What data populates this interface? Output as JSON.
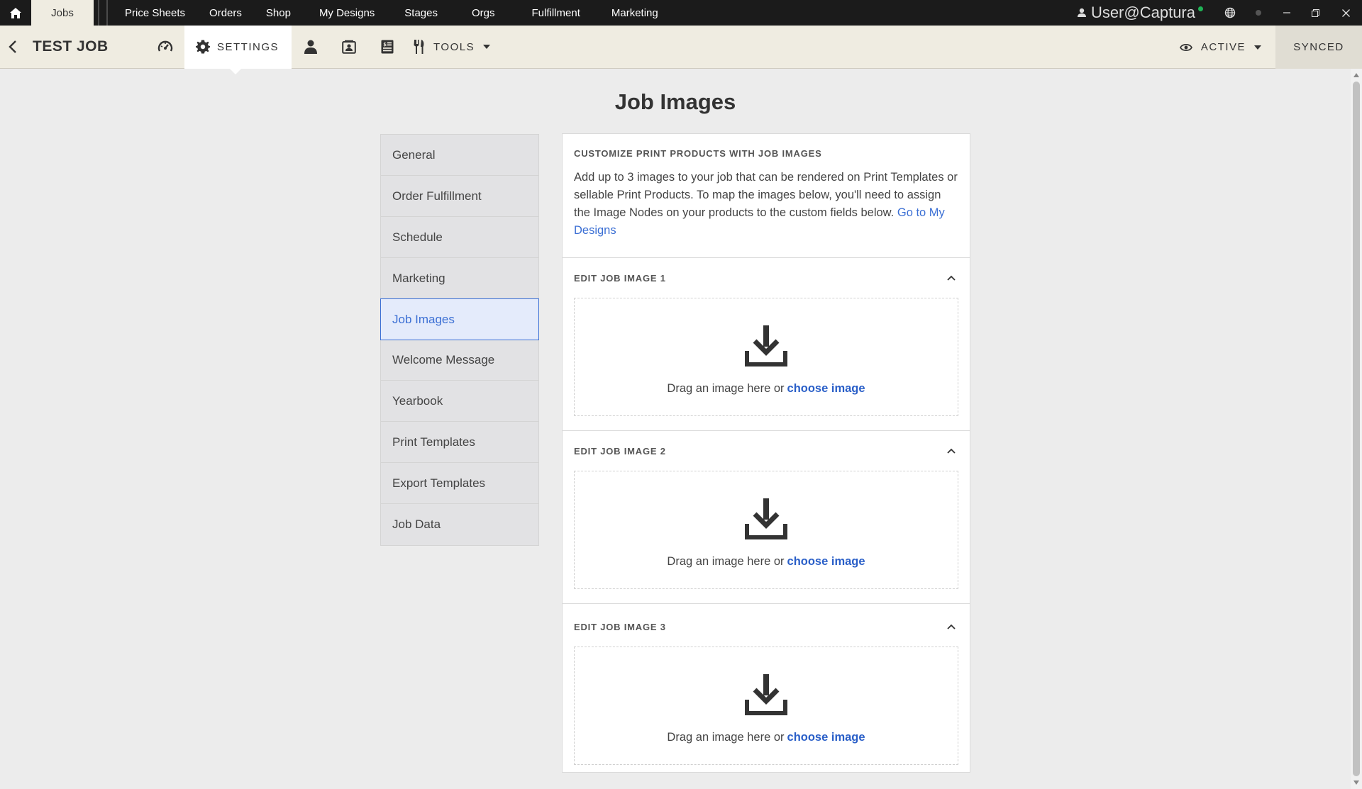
{
  "topnav": {
    "tabs": [
      "Jobs",
      "Price Sheets",
      "Orders",
      "Shop",
      "My Designs",
      "Stages",
      "Orgs",
      "Fulfillment",
      "Marketing"
    ],
    "user": "User@Captura",
    "icons": [
      "home-icon",
      "user-icon",
      "globe-icon",
      "minimize-icon",
      "restore-icon",
      "close-icon"
    ]
  },
  "subbar": {
    "job_title": "TEST JOB",
    "settings_label": "SETTINGS",
    "tools_label": "TOOLS",
    "status_label": "ACTIVE",
    "synced_label": "SYNCED"
  },
  "page": {
    "title": "Job Images"
  },
  "sidebar": {
    "items": [
      "General",
      "Order Fulfillment",
      "Schedule",
      "Marketing",
      "Job Images",
      "Welcome Message",
      "Yearbook",
      "Print Templates",
      "Export Templates",
      "Job Data"
    ],
    "active": "Job Images"
  },
  "panel": {
    "heading": "CUSTOMIZE PRINT PRODUCTS WITH JOB IMAGES",
    "description": "Add up to 3 images to your job that can be rendered on Print Templates or sellable Print Products. To map the images below, you'll need to assign the Image Nodes on your products to the custom fields below.",
    "link": "Go to My Designs",
    "sections": [
      {
        "title": "EDIT JOB IMAGE 1",
        "drop_text": "Drag an image here or",
        "choose_label": "choose image"
      },
      {
        "title": "EDIT JOB IMAGE 2",
        "drop_text": "Drag an image here or",
        "choose_label": "choose image"
      },
      {
        "title": "EDIT JOB IMAGE 3",
        "drop_text": "Drag an image here or",
        "choose_label": "choose image"
      }
    ]
  },
  "colors": {
    "topbar": "#1b1b1b",
    "subbar": "#efece1",
    "accent": "#3b6fd4",
    "online": "#1fb356"
  }
}
